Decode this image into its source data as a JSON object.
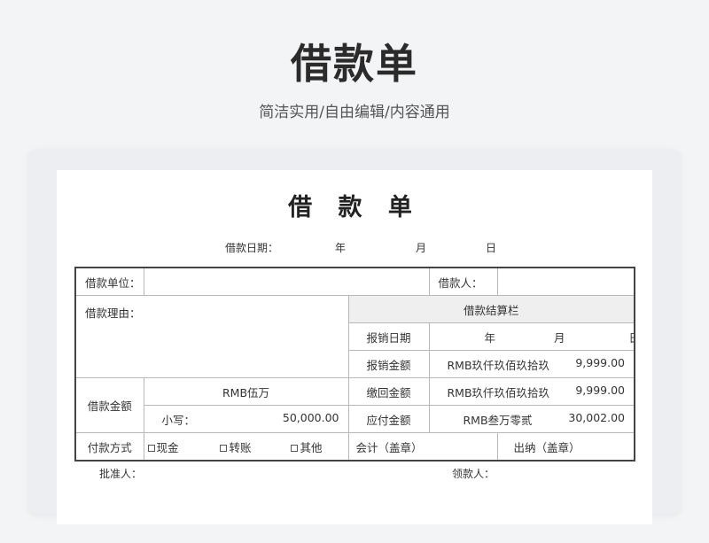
{
  "header": {
    "title": "借款单",
    "subtitle": "简洁实用/自由编辑/内容通用"
  },
  "form": {
    "title": "借 款 单",
    "date_label": "借款日期：",
    "year": "年",
    "month": "月",
    "day": "日",
    "unit_label": "借款单位：",
    "borrower_label": "借款人：",
    "reason_label": "借款理由：",
    "settlement_header": "借款结算栏",
    "reimburse_date_label": "报销日期",
    "reimburse_year": "年",
    "reimburse_month": "月",
    "reimburse_day": "日",
    "reimburse_amount_label": "报销金额",
    "reimburse_amount_words": "RMB玖仟玖佰玖拾玖",
    "reimburse_amount": "9,999.00",
    "loan_amount_label": "借款金额",
    "loan_amount_words": "RMB伍万",
    "return_amount_label": "缴回金额",
    "return_amount_words": "RMB玖仟玖佰玖拾玖",
    "return_amount": "9,999.00",
    "small_label": "小写：",
    "loan_amount_small": "50,000.00",
    "payable_label": "应付金额",
    "payable_words": "RMB叁万零贰",
    "payable_amount": "30,002.00",
    "pay_method_label": "付款方式",
    "pay_options": [
      "现金",
      "转账",
      "其他"
    ],
    "accountant_label": "会计（盖章）",
    "cashier_label": "出纳（盖章）",
    "approver_label": "批准人：",
    "receiver_label": "领款人："
  }
}
